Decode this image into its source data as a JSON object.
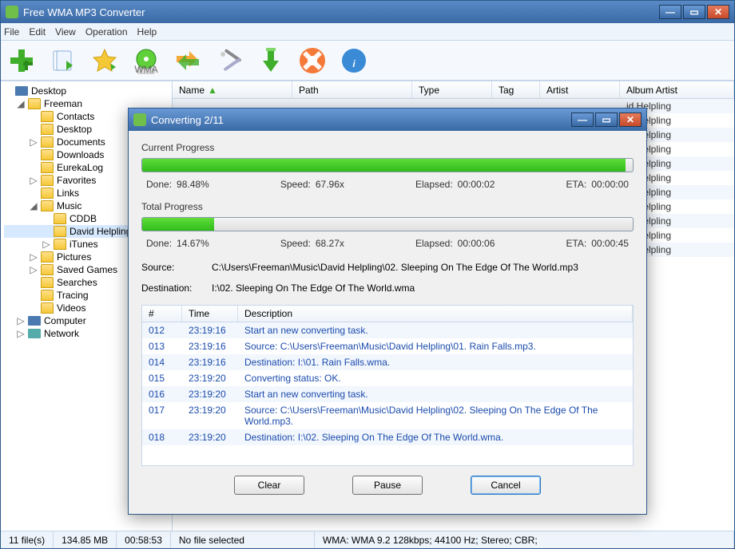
{
  "window": {
    "title": "Free WMA MP3 Converter",
    "menus": [
      "File",
      "Edit",
      "View",
      "Operation",
      "Help"
    ]
  },
  "columns": [
    "Name",
    "Path",
    "Type",
    "Tag",
    "Artist",
    "Album Artist"
  ],
  "rows_artist": "id Helpling",
  "tree": {
    "root": "Desktop",
    "user": "Freeman",
    "items": [
      "Contacts",
      "Desktop",
      "Documents",
      "Downloads",
      "EurekaLog",
      "Favorites",
      "Links",
      "Music"
    ],
    "music_children": [
      "CDDB",
      "David Helpling",
      "iTunes"
    ],
    "after_music": [
      "Pictures",
      "Saved Games",
      "Searches",
      "Tracing",
      "Videos"
    ],
    "computer": "Computer",
    "network": "Network"
  },
  "status": {
    "files": "11 file(s)",
    "size": "134.85 MB",
    "dur": "00:58:53",
    "sel": "No file selected",
    "fmt": "WMA:  WMA 9.2  128kbps; 44100 Hz; Stereo; CBR;"
  },
  "dialog": {
    "title": "Converting 2/11",
    "current_label": "Current Progress",
    "total_label": "Total Progress",
    "current": {
      "pct": 98.48,
      "done": "98.48%",
      "speed": "67.96x",
      "elapsed": "00:00:02",
      "eta": "00:00:00"
    },
    "total": {
      "pct": 14.67,
      "done": "14.67%",
      "speed": "68.27x",
      "elapsed": "00:00:06",
      "eta": "00:00:45"
    },
    "labels": {
      "done": "Done:",
      "speed": "Speed:",
      "elapsed": "Elapsed:",
      "eta": "ETA:",
      "source": "Source:",
      "dest": "Destination:"
    },
    "source": "C:\\Users\\Freeman\\Music\\David Helpling\\02.  Sleeping On The Edge Of The World.mp3",
    "dest": "I:\\02.  Sleeping On The Edge Of The World.wma",
    "log_cols": [
      "#",
      "Time",
      "Description"
    ],
    "log": [
      {
        "n": "012",
        "t": "23:19:16",
        "d": "Start an new converting task."
      },
      {
        "n": "013",
        "t": "23:19:16",
        "d": "Source:  C:\\Users\\Freeman\\Music\\David Helpling\\01.  Rain Falls.mp3."
      },
      {
        "n": "014",
        "t": "23:19:16",
        "d": "Destination: I:\\01.  Rain Falls.wma."
      },
      {
        "n": "015",
        "t": "23:19:20",
        "d": "Converting status: OK."
      },
      {
        "n": "016",
        "t": "23:19:20",
        "d": "Start an new converting task."
      },
      {
        "n": "017",
        "t": "23:19:20",
        "d": "Source:  C:\\Users\\Freeman\\Music\\David Helpling\\02.  Sleeping On The Edge Of The World.mp3."
      },
      {
        "n": "018",
        "t": "23:19:20",
        "d": "Destination: I:\\02.  Sleeping On The Edge Of The World.wma."
      }
    ],
    "buttons": {
      "clear": "Clear",
      "pause": "Pause",
      "cancel": "Cancel"
    }
  }
}
